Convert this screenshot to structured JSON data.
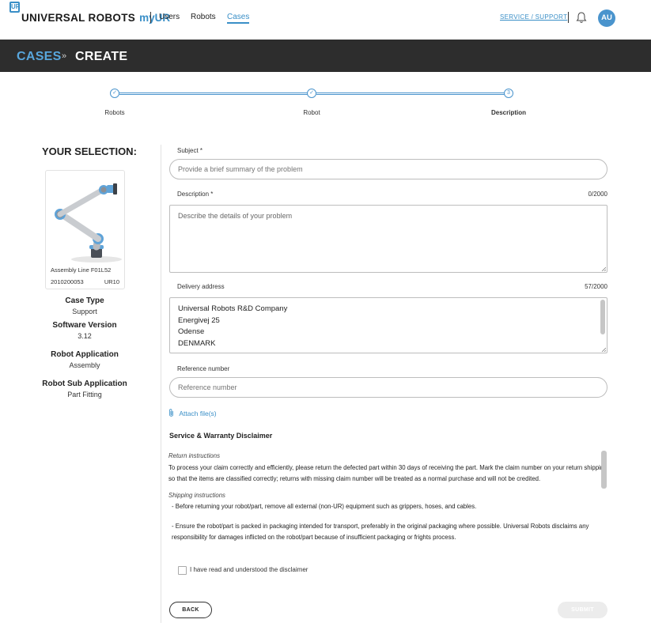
{
  "topbar": {
    "logo_mark": "UR",
    "logo_text": "UNIVERSAL ROBOTS",
    "logo_app": "myUR",
    "nav": [
      {
        "label": "Users",
        "active": false
      },
      {
        "label": "Robots",
        "active": false
      },
      {
        "label": "Cases",
        "active": true
      }
    ],
    "support_link": "SERVICE / SUPPORT",
    "avatar_initials": "AU",
    "accent_color": "#3a8fc7"
  },
  "header": {
    "section": "CASES",
    "separator": "»",
    "page": "CREATE",
    "background": "#2d2d2d"
  },
  "stepper": {
    "steps": [
      {
        "label": "Robots",
        "mark": "✓",
        "state": "done"
      },
      {
        "label": "Robot",
        "mark": "✓",
        "state": "done"
      },
      {
        "label": "Description",
        "mark": "3",
        "state": "current"
      }
    ]
  },
  "selection": {
    "title": "YOUR SELECTION:",
    "robot": {
      "name": "Assembly Line F01L52",
      "serial": "2010200053",
      "model": "UR10"
    },
    "details": [
      {
        "label": "Case Type",
        "value": "Support"
      },
      {
        "label": "Software Version",
        "value": "3.12"
      },
      {
        "label": "Robot Application",
        "value": "Assembly"
      },
      {
        "label": "Robot Sub Application",
        "value": "Part Fitting"
      }
    ]
  },
  "form": {
    "subject": {
      "label": "Subject *",
      "placeholder": "Provide a brief summary of the problem",
      "value": ""
    },
    "description": {
      "label": "Description *",
      "placeholder": "Describe the details of your problem",
      "value": "",
      "counter": "0/2000"
    },
    "delivery": {
      "label": "Delivery address",
      "counter": "57/2000",
      "lines": [
        "Universal Robots R&D Company",
        "Energivej 25",
        "Odense",
        "DENMARK"
      ]
    },
    "reference": {
      "label": "Reference number",
      "placeholder": "Reference number",
      "value": ""
    },
    "attach_label": "Attach file(s)"
  },
  "disclaimer": {
    "title": "Service & Warranty Disclaimer",
    "return_heading": "Return instructions",
    "return_text": "To process your claim correctly and efficiently, please return the defected part within 30 days of receiving the part. Mark the claim number on your return shipping so that the items are classified correctly; returns with missing claim number will be treated as a normal purchase and will not be credited.",
    "shipping_heading": "Shipping instructions",
    "shipping_items": [
      "- Before returning your robot/part, remove all external (non-UR) equipment such as grippers, hoses, and cables.",
      "- Ensure the robot/part is packed in packaging intended for transport, preferably in the original packaging where possible. Universal Robots disclaims any responsibility for damages inflicted on the robot/part because of insufficient packaging or frights process."
    ],
    "checkbox_label": "I have read and understood the disclaimer",
    "checked": false
  },
  "actions": {
    "back": "BACK",
    "submit": "SUBMIT"
  }
}
